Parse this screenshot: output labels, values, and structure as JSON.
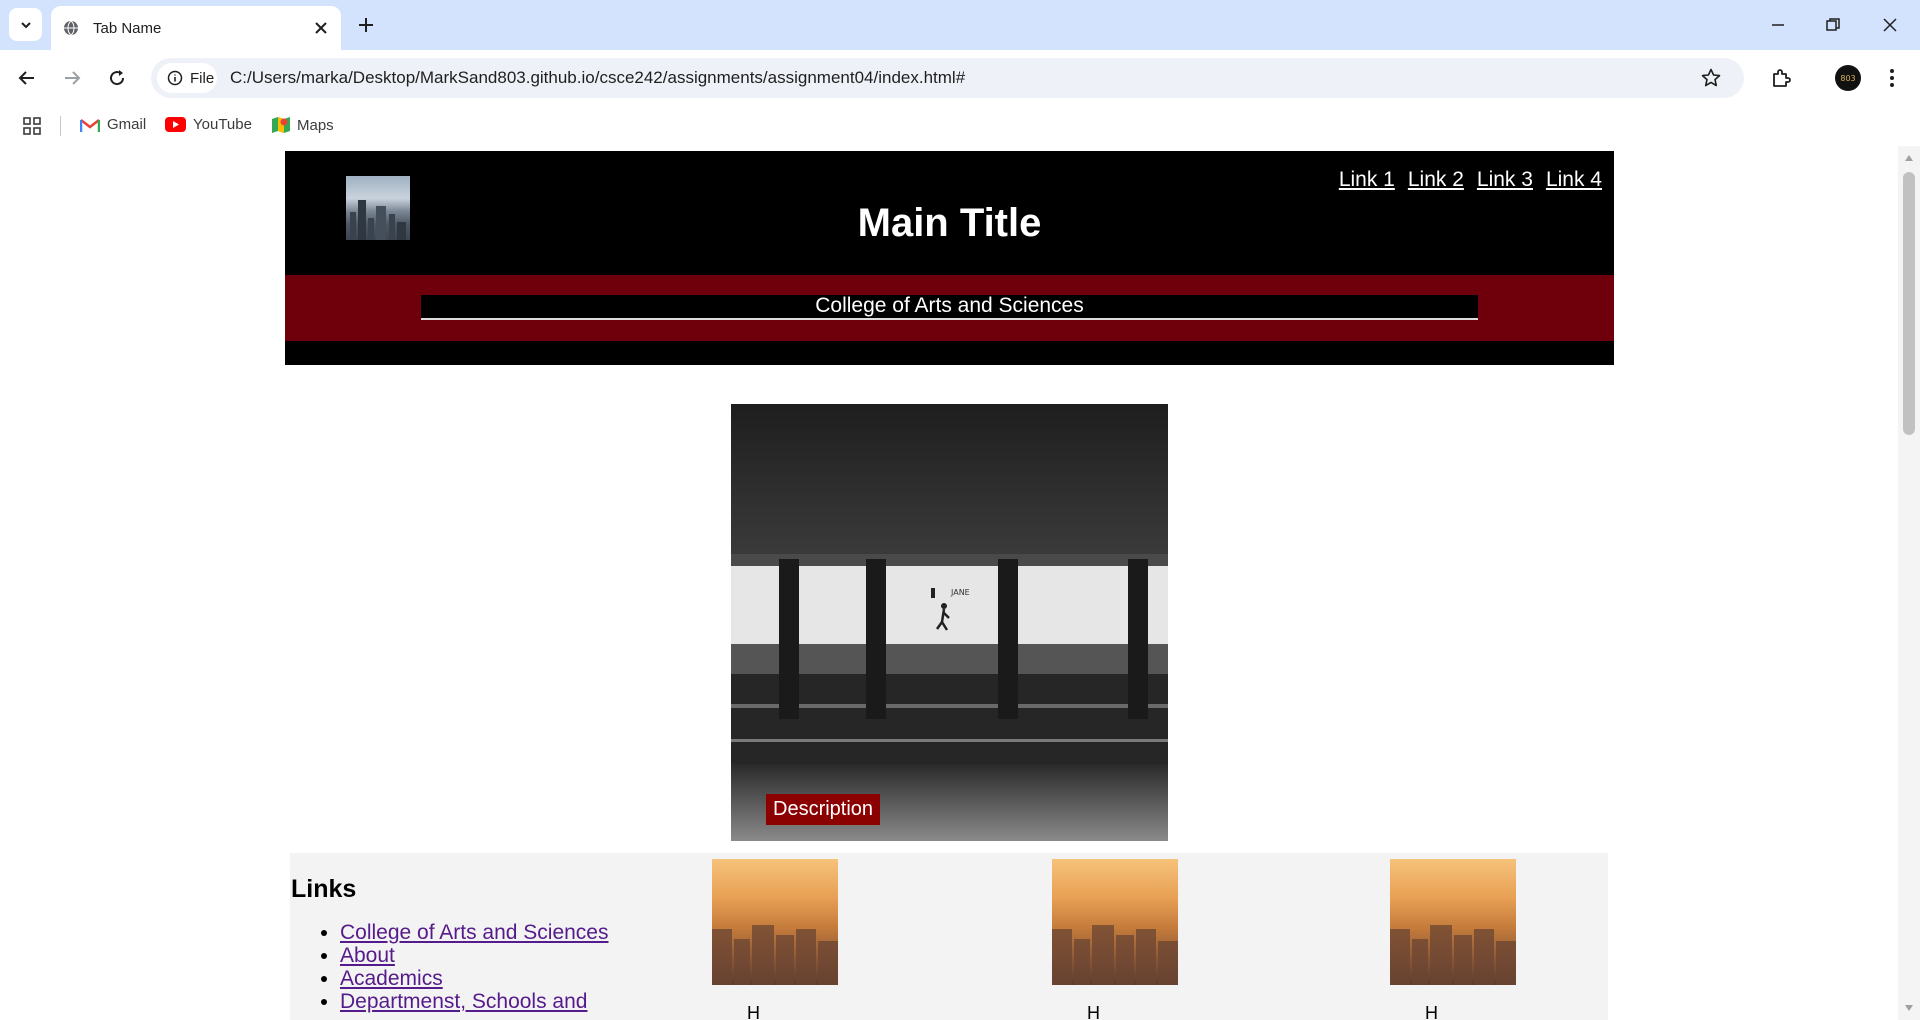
{
  "browser": {
    "tab_title": "Tab Name",
    "site_chip": "File",
    "url": "C:/Users/marka/Desktop/MarkSand803.github.io/csce242/assignments/assignment04/index.html#",
    "bookmarks": [
      {
        "label": "Gmail",
        "icon": "gmail-icon"
      },
      {
        "label": "YouTube",
        "icon": "youtube-icon"
      },
      {
        "label": "Maps",
        "icon": "maps-icon"
      }
    ],
    "profile_initials": "803"
  },
  "page": {
    "header": {
      "nav_links": [
        "Link 1",
        "Link 2",
        "Link 3",
        "Link 4"
      ],
      "title": "Main Title",
      "band_text": "College of Arts and Sciences"
    },
    "hero": {
      "description": "Description",
      "sign_text": "JANE",
      "small_sign": "1"
    },
    "links_section": {
      "heading": "Links",
      "items": [
        "College of Arts and Sciences",
        "About",
        "Academics",
        "Departmenst, Schools and"
      ]
    },
    "thumbnails": [
      {
        "label": "H"
      },
      {
        "label": "H"
      },
      {
        "label": "H"
      }
    ]
  },
  "colors": {
    "tabstrip": "#d3e3fd",
    "header_band": "#6f000b",
    "description_bg": "#8b0000",
    "visited_link": "#551a8b"
  }
}
